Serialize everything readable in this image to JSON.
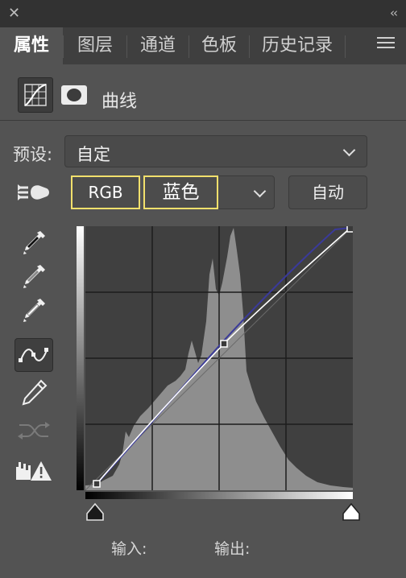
{
  "window": {
    "close_glyph": "✕",
    "collapse_glyph": "‹‹"
  },
  "tabs": [
    {
      "label": "属性",
      "active": true
    },
    {
      "label": "图层",
      "active": false
    },
    {
      "label": "通道",
      "active": false
    },
    {
      "label": "色板",
      "active": false
    },
    {
      "label": "历史记录",
      "active": false
    }
  ],
  "header": {
    "title": "曲线",
    "adjustment_icon": "curves-adjustment-icon",
    "mask_icon": "layer-mask-icon"
  },
  "preset": {
    "label": "预设:",
    "value": "自定"
  },
  "channel": {
    "rgb_label": "RGB",
    "selected": "蓝色",
    "auto_label": "自动",
    "highlight_color": "#f2e06c"
  },
  "tools": [
    "on-image-adjust-icon",
    "black-point-eyedropper-icon",
    "gray-point-eyedropper-icon",
    "white-point-eyedropper-icon",
    "point-curve-icon",
    "pencil-draw-icon",
    "smooth-curve-icon",
    "clipping-warning-icon"
  ],
  "curve": {
    "control_points": [
      [
        10,
        2
      ],
      [
        130,
        130
      ],
      [
        255,
        255
      ]
    ],
    "line_color": "#ffffff",
    "blue_curve_color": "#3a3a9a"
  },
  "footer": {
    "input_label": "输入:",
    "output_label": "输出:"
  }
}
